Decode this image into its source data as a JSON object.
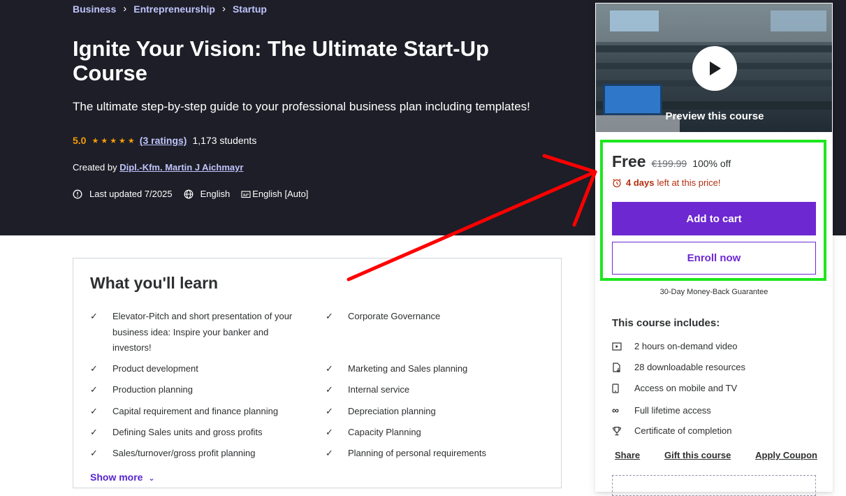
{
  "breadcrumb": [
    "Business",
    "Entrepreneurship",
    "Startup"
  ],
  "course": {
    "title": "Ignite Your Vision: The Ultimate Start-Up Course",
    "subtitle": "The ultimate step-by-step guide to your professional business plan including templates!",
    "rating": "5.0",
    "stars": "★★★★★",
    "ratings_count": "(3 ratings)",
    "students": "1,173 students",
    "created_by_label": "Created by",
    "instructor": "Dipl.-Kfm. Martin J Aichmayr",
    "last_updated": "Last updated 7/2025",
    "language": "English",
    "captions": "English [Auto]"
  },
  "learn": {
    "heading": "What you'll learn",
    "items": [
      "Elevator-Pitch and short presentation of your business idea: Inspire your banker and investors!",
      "Corporate Governance",
      "Product development",
      "Marketing and Sales planning",
      "Production planning",
      "Internal service",
      "Capital requirement and finance planning",
      "Depreciation planning",
      "Defining Sales units and gross profits",
      "Capacity Planning",
      "Sales/turnover/gross profit planning",
      "Planning of personal requirements"
    ],
    "show_more": "Show more"
  },
  "sidebar": {
    "preview_label": "Preview this course",
    "price": "Free",
    "original_price": "€199.99",
    "discount": "100% off",
    "days_left": "4 days",
    "days_left_suffix": "left at this price!",
    "add_to_cart": "Add to cart",
    "enroll_now": "Enroll now",
    "guarantee": "30-Day Money-Back Guarantee",
    "includes_heading": "This course includes:",
    "includes": [
      {
        "icon": "video-icon",
        "label": "2 hours on-demand video"
      },
      {
        "icon": "download-file-icon",
        "label": "28 downloadable resources"
      },
      {
        "icon": "mobile-icon",
        "label": "Access on mobile and TV"
      },
      {
        "icon": "infinity-icon",
        "label": "Full lifetime access"
      },
      {
        "icon": "trophy-icon",
        "label": "Certificate of completion"
      }
    ],
    "links": [
      "Share",
      "Gift this course",
      "Apply Coupon"
    ]
  },
  "colors": {
    "hero_bg": "#1d1e27",
    "accent_purple": "#6d28d2",
    "star_orange": "#f69c08",
    "timer_red": "#b32d0f",
    "highlight_green": "#1ee61e",
    "annotation_arrow_red": "#ff0000"
  }
}
